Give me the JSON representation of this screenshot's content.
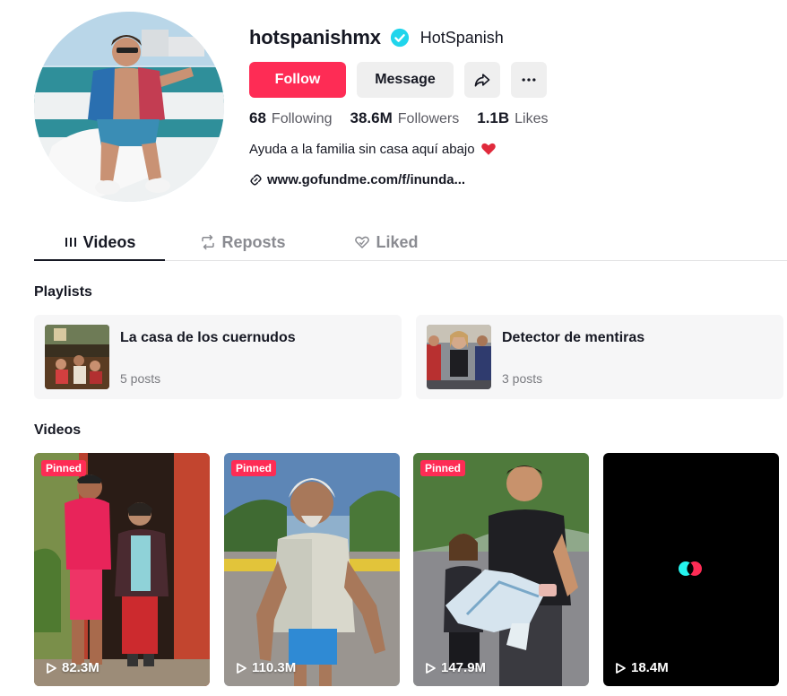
{
  "profile": {
    "username": "hotspanishmx",
    "nickname": "HotSpanish",
    "verified_icon": "verified-badge-icon",
    "follow_label": "Follow",
    "message_label": "Message",
    "share_icon": "share-icon",
    "more_icon": "more-icon",
    "stats": {
      "following_count": "68",
      "following_label": "Following",
      "followers_count": "38.6M",
      "followers_label": "Followers",
      "likes_count": "1.1B",
      "likes_label": "Likes"
    },
    "bio": "Ayuda a la familia sin casa aquí abajo",
    "bio_emoji": "heart-icon",
    "link": "www.gofundme.com/f/inunda..."
  },
  "tabs": [
    {
      "label": "Videos",
      "icon": "grid-icon",
      "active": true
    },
    {
      "label": "Reposts",
      "icon": "repost-icon",
      "active": false
    },
    {
      "label": "Liked",
      "icon": "liked-heart-icon",
      "active": false
    }
  ],
  "playlists_title": "Playlists",
  "playlists": [
    {
      "name": "La casa de los cuernudos",
      "count": "5 posts"
    },
    {
      "name": "Detector de mentiras",
      "count": "3 posts"
    }
  ],
  "videos_title": "Videos",
  "videos": [
    {
      "pinned": "Pinned",
      "views": "82.3M"
    },
    {
      "pinned": "Pinned",
      "views": "110.3M"
    },
    {
      "pinned": "Pinned",
      "views": "147.9M"
    },
    {
      "pinned": "",
      "views": "18.4M"
    }
  ],
  "colors": {
    "accent": "#fe2c55",
    "verified": "#20d5ec",
    "text": "#161823",
    "muted": "#8a8b91"
  }
}
